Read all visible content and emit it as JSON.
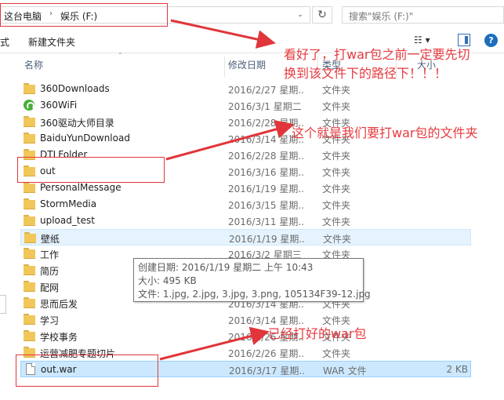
{
  "address": {
    "crumbs": [
      "这台电脑",
      "娱乐 (F:)"
    ],
    "separator": "›",
    "dropdown": "⌄",
    "refresh": "↻",
    "search_placeholder": "搜索\"娱乐 (F:)\""
  },
  "toolbar": {
    "left_partial": "式",
    "new_folder_label": "新建文件夹",
    "view_label": "☷ ▾",
    "help_label": "?"
  },
  "columns": {
    "name": "名称",
    "date": "修改日期",
    "type": "类型",
    "size": "大小"
  },
  "files": [
    {
      "name": "360Downloads",
      "date": "2016/2/27 星期...",
      "type": "文件夹",
      "size": "",
      "icon": "folder-icon"
    },
    {
      "name": "360WiFi",
      "date": "2016/3/1 星期二 ...",
      "type": "文件夹",
      "size": "",
      "icon": "wifi-icon"
    },
    {
      "name": "360驱动大师目录",
      "date": "2016/2/28 星期...",
      "type": "文件夹",
      "size": "",
      "icon": "folder-icon"
    },
    {
      "name": "BaiduYunDownload",
      "date": "2016/3/14 星期...",
      "type": "文件夹",
      "size": "",
      "icon": "folder-icon"
    },
    {
      "name": "DTLFolder",
      "date": "2016/2/28 星期...",
      "type": "文件夹",
      "size": "",
      "icon": "folder-icon"
    },
    {
      "name": "out",
      "date": "2016/3/16 星期...",
      "type": "文件夹",
      "size": "",
      "icon": "folder-icon"
    },
    {
      "name": "PersonalMessage",
      "date": "2016/1/19 星期...",
      "type": "文件夹",
      "size": "",
      "icon": "folder-icon"
    },
    {
      "name": "StormMedia",
      "date": "2016/3/15 星期...",
      "type": "文件夹",
      "size": "",
      "icon": "folder-icon"
    },
    {
      "name": "upload_test",
      "date": "2016/3/11 星期...",
      "type": "文件夹",
      "size": "",
      "icon": "folder-icon"
    },
    {
      "name": "壁纸",
      "date": "2016/1/19 星期...",
      "type": "文件夹",
      "size": "",
      "icon": "folder-icon",
      "state": "hovered"
    },
    {
      "name": "工作",
      "date": "2016/3/2 星期三 ...",
      "type": "文件夹",
      "size": "",
      "icon": "folder-icon"
    },
    {
      "name": "简历",
      "date": "",
      "type": "文件夹",
      "size": "",
      "icon": "folder-icon"
    },
    {
      "name": "配网",
      "date": "",
      "type": "文件夹",
      "size": "",
      "icon": "folder-icon"
    },
    {
      "name": "思而后发",
      "date": "2016/3/14 星期...",
      "type": "文件夹",
      "size": "",
      "icon": "folder-icon"
    },
    {
      "name": "学习",
      "date": "2016/3/14 星期...",
      "type": "文件夹",
      "size": "",
      "icon": "folder-icon"
    },
    {
      "name": "学校事务",
      "date": "2016/2/26 星期...",
      "type": "文件夹",
      "size": "",
      "icon": "folder-icon"
    },
    {
      "name": "运营减肥专题切片",
      "date": "2016/2/26 星期...",
      "type": "文件夹",
      "size": "",
      "icon": "folder-icon"
    },
    {
      "name": "out.war",
      "date": "2016/3/17 星期...",
      "type": "WAR 文件",
      "size": "2 KB",
      "icon": "file-icon",
      "state": "selected"
    }
  ],
  "tooltip": {
    "created": "创建日期: 2016/1/19 星期二 上午 10:43",
    "size": "大小: 495 KB",
    "files": "文件: 1.jpg, 2.jpg, 3.jpg, 3.png, 105134F39-12.jpg"
  },
  "annotations": {
    "note1_line1": "看好了，打war包之前一定要先切",
    "note1_line2": "换到该文件下的路径下！！！",
    "note2": "这个就是我们要打war包的文件夹",
    "note3": "已经打好的war包",
    "color": "#e63a3f"
  }
}
